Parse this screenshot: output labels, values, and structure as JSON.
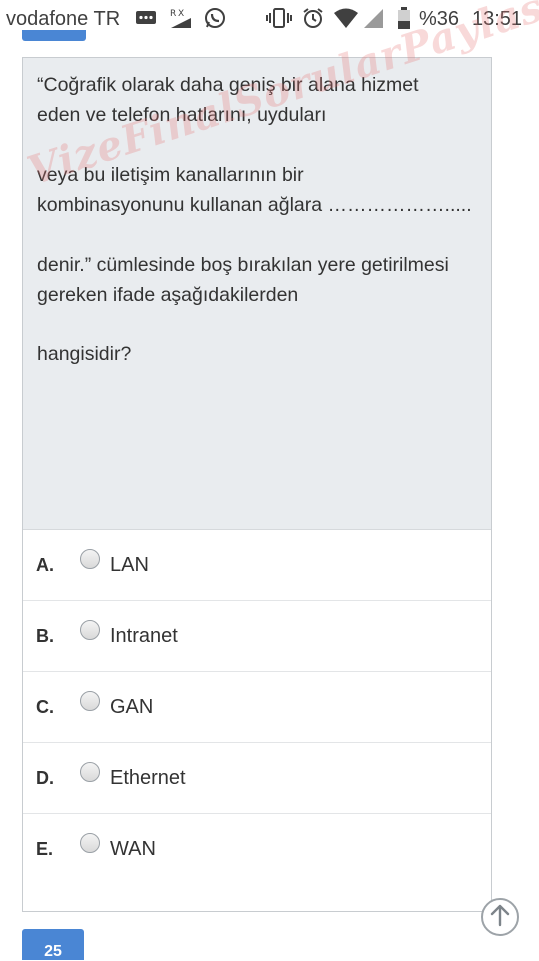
{
  "status_bar": {
    "carrier": "vodafone TR",
    "battery_percent": "%36",
    "time": "13:51",
    "icons": [
      "message-icon",
      "data-signal-icon",
      "whatsapp-icon",
      "vibrate-icon",
      "alarm-icon",
      "wifi-icon",
      "cell-signal-icon",
      "battery-icon"
    ]
  },
  "question": {
    "lines": [
      "“Coğrafik olarak daha geniş bir alana hizmet",
      "eden ve telefon hatlarını, uyduları",
      "veya bu iletişim kanallarının bir",
      "kombinasyonunu kullanan ağlara ……………….....",
      "denir.” cümlesinde boş bırakılan yere getirilmesi",
      "gereken ifade aşağıdakilerden",
      "hangisidir?"
    ]
  },
  "options": [
    {
      "letter": "A.",
      "label": "LAN"
    },
    {
      "letter": "B.",
      "label": "Intranet"
    },
    {
      "letter": "C.",
      "label": "GAN"
    },
    {
      "letter": "D.",
      "label": "Ethernet"
    },
    {
      "letter": "E.",
      "label": "WAN"
    }
  ],
  "next_question_number": "25",
  "watermark": "VizeFinalSorularPaylasimi.com",
  "colors": {
    "accent": "#4a86d4",
    "question_bg": "#e9ecef"
  }
}
